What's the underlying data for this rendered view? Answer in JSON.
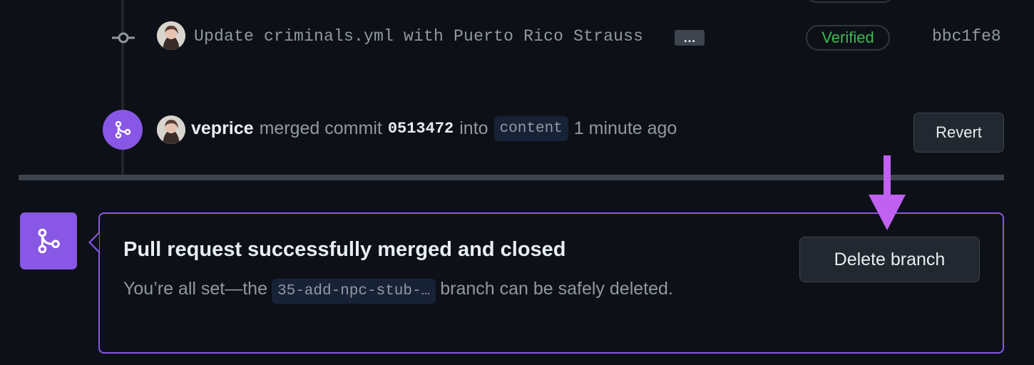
{
  "commit": {
    "message": "Update criminals.yml with Puerto Rico Strauss",
    "ellipsis": "…",
    "verified_label": "Verified",
    "sha": "bbc1fe8"
  },
  "merge_event": {
    "user": "veprice",
    "text_merged": "merged commit",
    "commit_sha": "0513472",
    "text_into": "into",
    "target_branch": "content",
    "time": "1 minute ago",
    "revert_label": "Revert"
  },
  "merged_box": {
    "title": "Pull request successfully merged and closed",
    "desc_prefix": "You’re all set—the",
    "branch": "35-add-npc-stub-…",
    "desc_suffix": "branch can be safely deleted.",
    "delete_label": "Delete branch"
  },
  "colors": {
    "accent_purple": "#8957e5",
    "arrow_magenta": "#c061f0",
    "verified_green": "#3fb950"
  }
}
